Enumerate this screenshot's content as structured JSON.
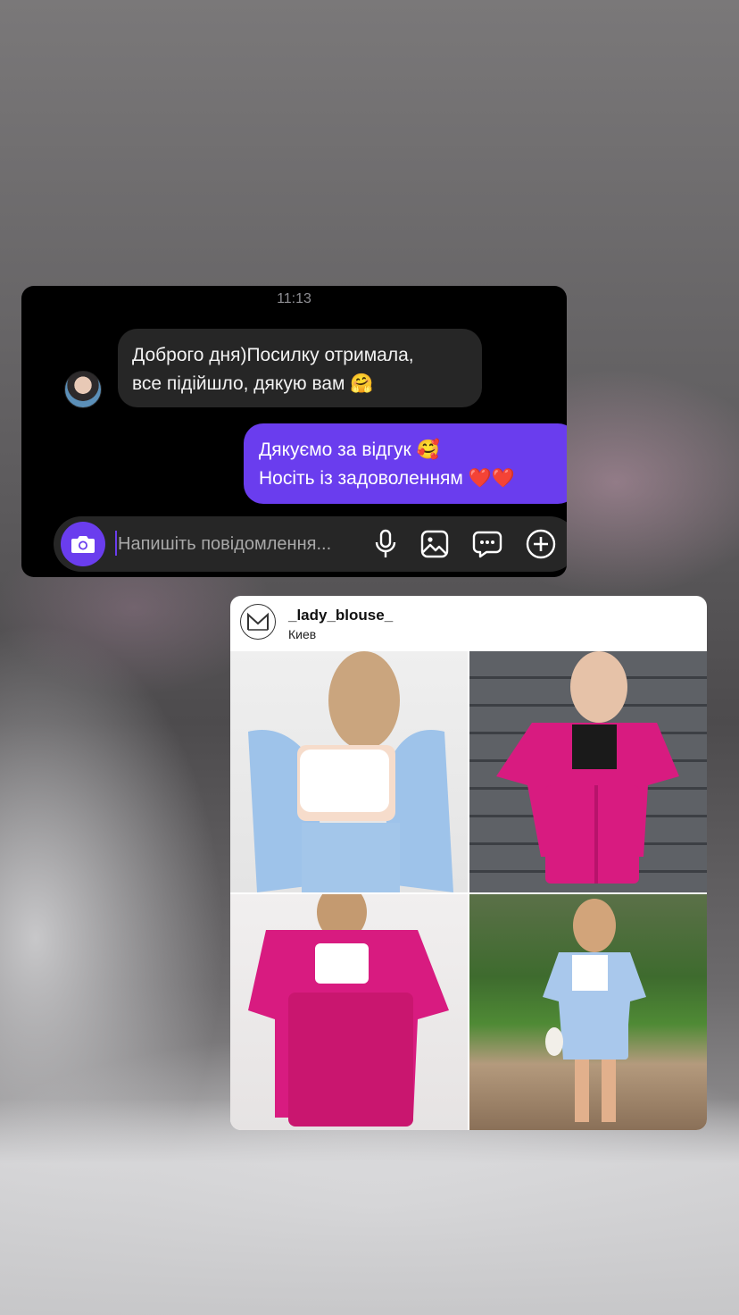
{
  "chat": {
    "time": "11:13",
    "incoming": {
      "line1": "Доброго дня)Посилку отримала,",
      "line2": "все підійшло, дякую вам 🤗"
    },
    "outgoing": {
      "line1": "Дякуємо за відгук 🥰",
      "line2": "Носіть із задоволенням ❤️❤️"
    },
    "composer": {
      "placeholder": "Напишіть повідомлення..."
    },
    "colors": {
      "accent": "#6a3dee",
      "bubble_in": "#262626",
      "background": "#000000"
    },
    "icons": [
      "camera-icon",
      "microphone-icon",
      "gallery-icon",
      "sticker-icon",
      "plus-icon"
    ]
  },
  "post": {
    "username": "_lady_blouse_",
    "location": "Киев",
    "logo_letter": "M",
    "photos": [
      {
        "shirt": "#9ec3ea",
        "shorts": "#9ec3ea"
      },
      {
        "shirt": "#d81b80",
        "shorts": "#d81b80"
      },
      {
        "shirt": "#d81b80",
        "shorts": "#d81b80"
      },
      {
        "shirt": "#a9c8ec",
        "shorts": "#a9c8ec"
      }
    ]
  }
}
